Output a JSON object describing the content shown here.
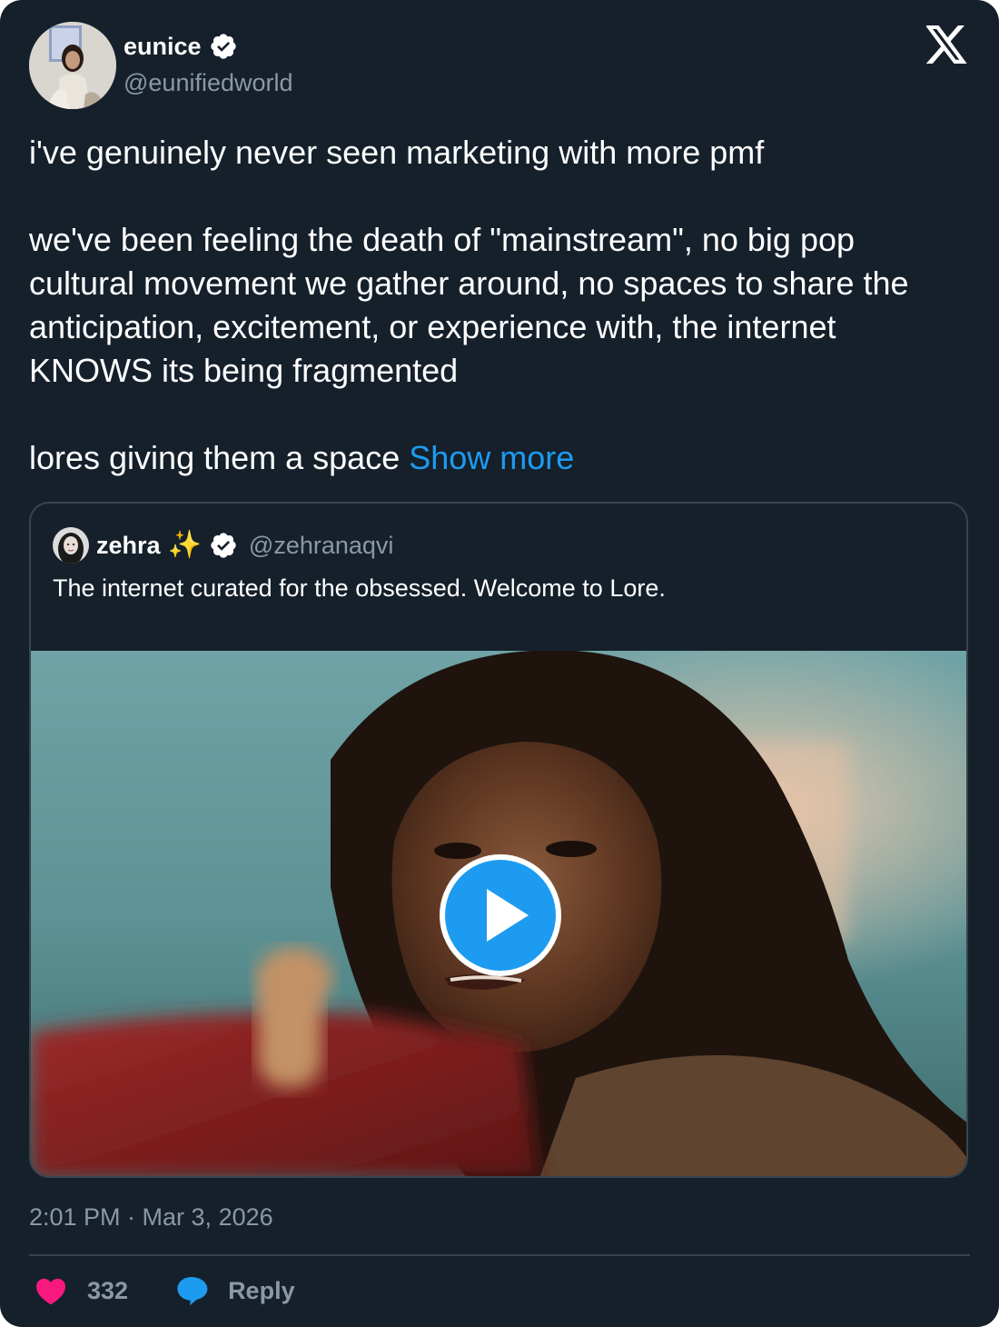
{
  "author": {
    "name": "eunice",
    "handle": "@eunifiedworld",
    "verified": true
  },
  "tweet": {
    "paragraphs": [
      "i've genuinely never seen marketing with more pmf",
      "we've been feeling the death of \"mainstream\", no big pop cultural movement we gather around, no spaces to share the anticipation, excitement, or experience with, the internet KNOWS its being fragmented",
      "lores giving them a space"
    ],
    "show_more": "Show more"
  },
  "quoted_tweet": {
    "name": "zehra",
    "emoji": "✨",
    "handle": "@zehranaqvi",
    "verified": true,
    "text": "The internet curated for the obsessed. Welcome to Lore.",
    "media_type": "video"
  },
  "timestamp": "2:01 PM · Mar 3, 2026",
  "actions": {
    "likes": "332",
    "reply_label": "Reply"
  },
  "colors": {
    "background": "#15202b",
    "text": "#e7e9ea",
    "secondary_text": "#8b98a5",
    "accent": "#1d9bf0",
    "like": "#f91880",
    "border": "#38444d"
  },
  "icons": {
    "logo": "x-logo-icon",
    "verified": "verified-badge-icon",
    "play": "play-icon",
    "like": "heart-icon",
    "reply": "speech-bubble-icon"
  }
}
